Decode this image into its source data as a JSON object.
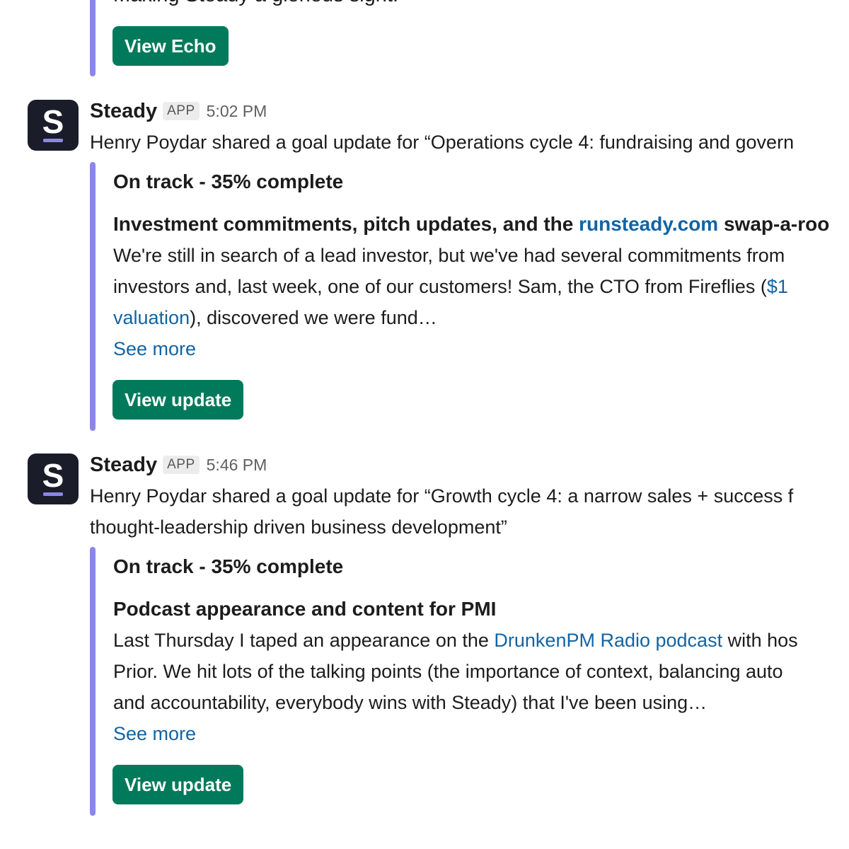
{
  "previous": {
    "clipped_text": "Making Steady a glorious sight.",
    "button_label": "View Echo"
  },
  "messages": [
    {
      "avatar_letter": "S",
      "sender": "Steady",
      "badge": "APP",
      "time": "5:02 PM",
      "lines": [
        "Henry Poydar shared a goal update for “Operations cycle 4: fundraising and govern"
      ],
      "status": "On track - 35% complete",
      "title": {
        "before": "Investment commitments, pitch updates, and the ",
        "link": "runsteady.com",
        "after": " swap-a-roo"
      },
      "body": {
        "line1": "We're still in search of a lead investor, but we've had several commitments from",
        "line2_before": "investors and, last week, one of our customers! Sam, the CTO from Fireflies (",
        "line2_link": "$1",
        "line3_link": "valuation",
        "line3_after": "), discovered we were fund…"
      },
      "see_more": "See more",
      "button_label": "View update"
    },
    {
      "avatar_letter": "S",
      "sender": "Steady",
      "badge": "APP",
      "time": "5:46 PM",
      "lines": [
        "Henry Poydar shared a goal update for “Growth cycle 4: a narrow sales + success f",
        "thought-leadership driven business development”"
      ],
      "status": "On track - 35% complete",
      "title": {
        "text": "Podcast appearance and content for PMI"
      },
      "body": {
        "line1_before": "Last Thursday I taped an appearance on the ",
        "line1_link": "DrunkenPM Radio podcast",
        "line1_after": " with hos",
        "line2": "Prior. We hit lots of the talking points (the importance of context, balancing auto",
        "line3": "and accountability, everybody wins with Steady) that I've been using…"
      },
      "see_more": "See more",
      "button_label": "View update"
    }
  ]
}
